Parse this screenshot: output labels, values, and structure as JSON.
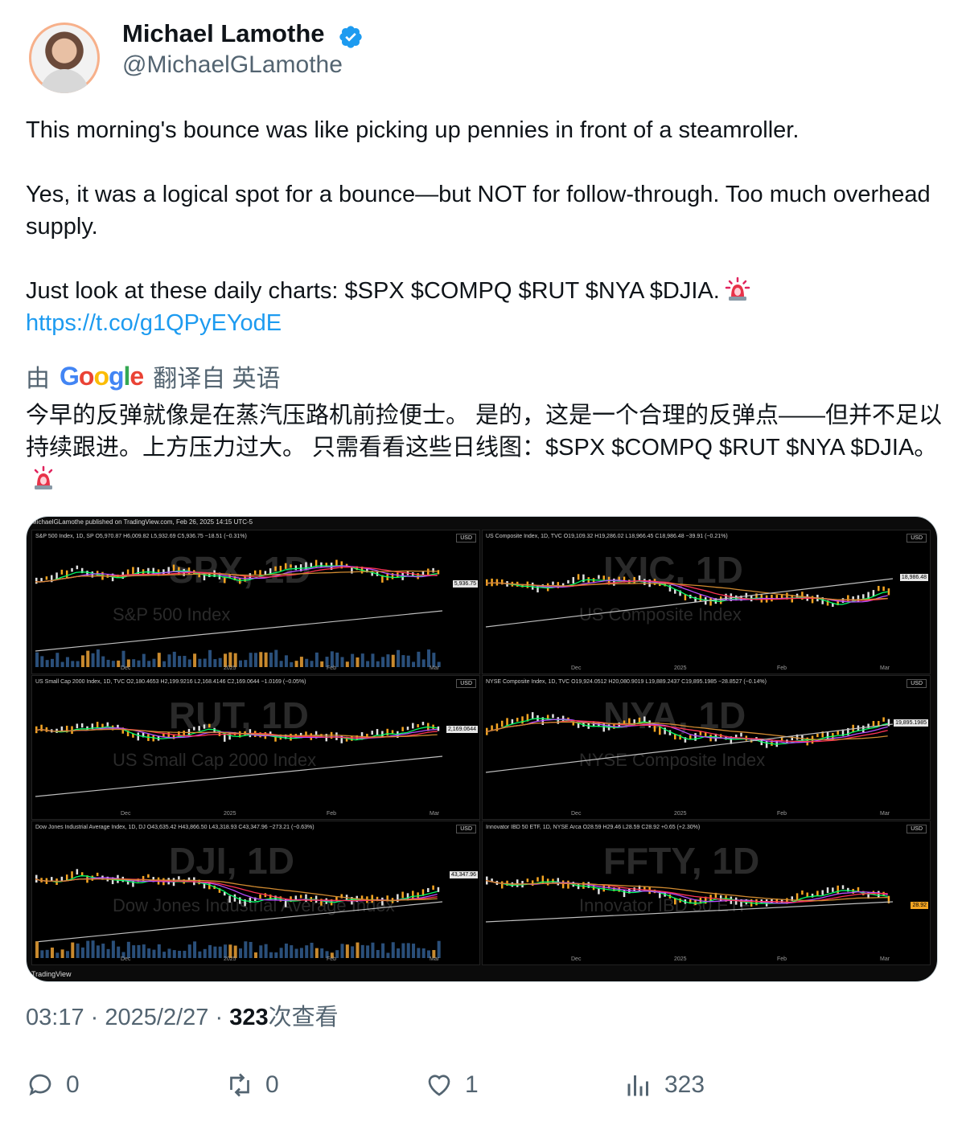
{
  "author": {
    "name": "Michael Lamothe",
    "handle": "@MichaelGLamothe",
    "verified_icon": "verified-badge-icon"
  },
  "tweet": {
    "p1": "This morning's bounce was like picking up pennies in front of a steamroller.",
    "p2": "Yes, it was a logical spot for a bounce—but NOT for follow-through. Too much overhead supply.",
    "p3": "Just look at these daily charts: $SPX $COMPQ $RUT $NYA $DJIA.",
    "link": "https://t.co/g1QPyEYodE",
    "emoji": "rotating-light-icon"
  },
  "translation": {
    "prefix": "由",
    "provider": "Google",
    "suffix": "翻译自 英语",
    "text": "今早的反弹就像是在蒸汽压路机前捡便士。 是的，这是一个合理的反弹点——但并不足以持续跟进。上方压力过大。 只需看看这些日线图：$SPX $COMPQ $RUT $NYA $DJIA。"
  },
  "media": {
    "header": "MichaelGLamothe published on TradingView.com, Feb 26, 2025 14:15 UTC-5",
    "footer": "TradingView",
    "panels": [
      {
        "title": "S&P 500 Index, 1D, SP  O5,970.87 H6,009.82 L5,932.69 C5,936.75 −18.51 (−0.31%)",
        "sym": "SPX, 1D",
        "name": "S&P 500 Index",
        "price": "5,936.75"
      },
      {
        "title": "US Composite Index, 1D, TVC  O19,109.32 H19,286.02 L18,966.45 C18,986.48 −39.91 (−0.21%)",
        "sym": "IXIC, 1D",
        "name": "US Composite Index",
        "price": "18,986.48"
      },
      {
        "title": "US Small Cap 2000 Index, 1D, TVC  O2,180.4653 H2,199.9216 L2,168.4146 C2,169.0644 −1.0169 (−0.05%)",
        "sym": "RUT, 1D",
        "name": "US Small Cap 2000 Index",
        "price": "2,169.0644"
      },
      {
        "title": "NYSE Composite Index, 1D, TVC  O19,924.0512 H20,080.9019 L19,889.2437 C19,895.1985 −28.8527 (−0.14%)",
        "sym": "NYA, 1D",
        "name": "NYSE Composite Index",
        "price": "19,895.1985"
      },
      {
        "title": "Dow Jones Industrial Average Index, 1D, DJ  O43,635.42 H43,866.50 L43,318.93 C43,347.96 −273.21 (−0.63%)",
        "sym": "DJI, 1D",
        "name": "Dow Jones Industrial Average Index",
        "price": "43,347.96"
      },
      {
        "title": "Innovator IBD 50 ETF, 1D, NYSE Arca  O28.59 H29.46 L28.59 C28.92 +0.65 (+2.30%)",
        "sym": "FFTY, 1D",
        "name": "Innovator IBD 50 ETF",
        "price": "28.92"
      }
    ],
    "axis_labels": [
      "Dec",
      "2025",
      "Feb",
      "Mar"
    ],
    "currency": "USD"
  },
  "meta": {
    "time": "03:17",
    "date": "2025/2/27",
    "views_count": "323",
    "views_label": "次查看",
    "sep": "·"
  },
  "actions": {
    "replies": "0",
    "reposts": "0",
    "likes": "1",
    "views": "323"
  }
}
